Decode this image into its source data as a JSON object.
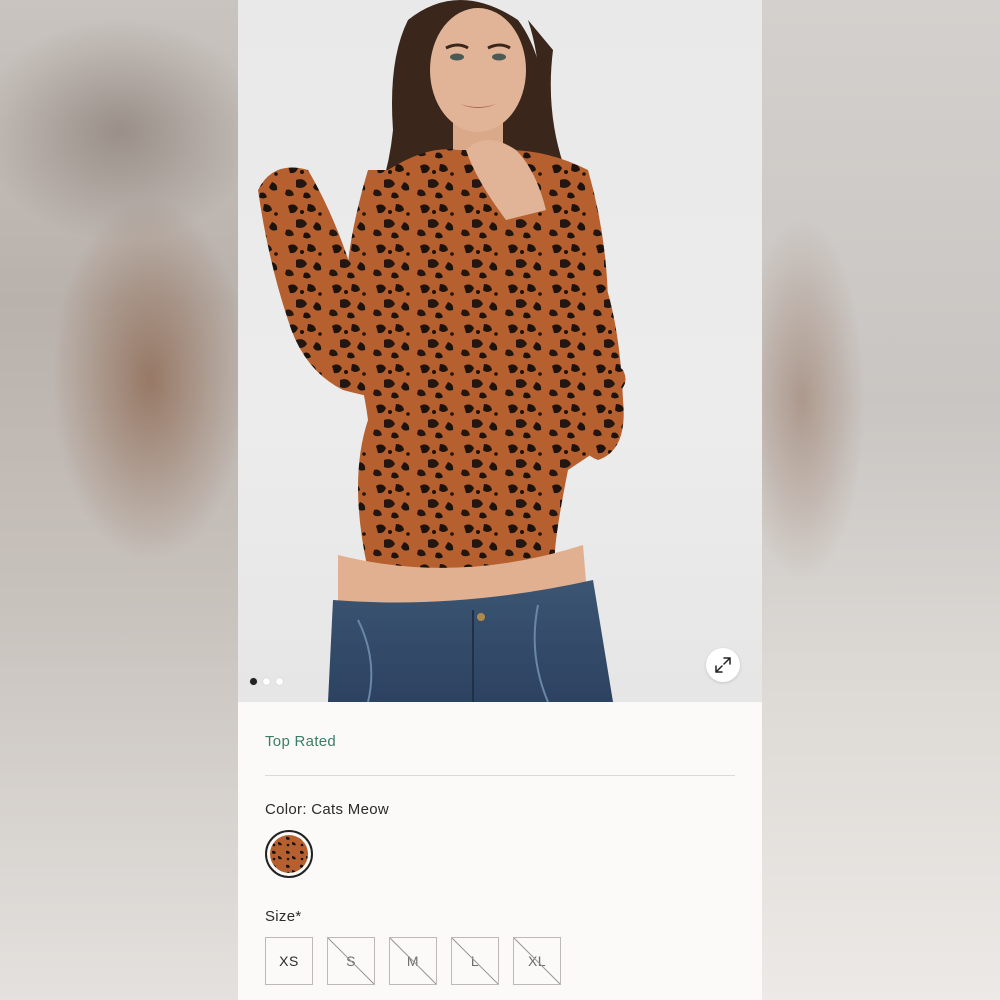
{
  "product": {
    "badge": "Top Rated",
    "color_label": "Color: Cats Meow",
    "color_swatch_name": "leopard-swatch",
    "size_label": "Size*",
    "sizes": [
      {
        "label": "XS",
        "available": true
      },
      {
        "label": "S",
        "available": false
      },
      {
        "label": "M",
        "available": false
      },
      {
        "label": "L",
        "available": false
      },
      {
        "label": "XL",
        "available": false
      }
    ]
  },
  "gallery": {
    "image_count": 3,
    "active_index": 0,
    "expand_icon": "expand-arrows-icon"
  },
  "colors": {
    "badge_green": "#3c7d6a",
    "text": "#2b2b2b",
    "border": "#bdbab5"
  }
}
